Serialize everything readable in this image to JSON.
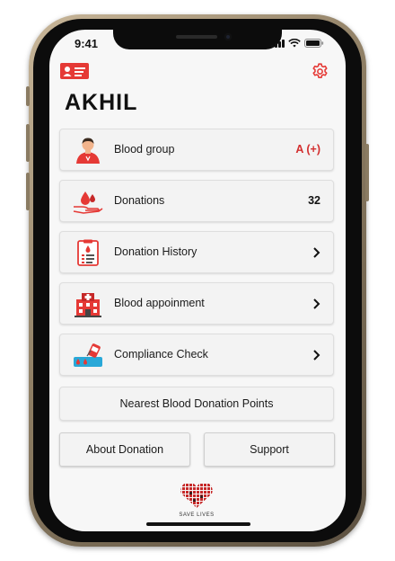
{
  "status_bar": {
    "time": "9:41"
  },
  "header": {
    "user_name": "AKHIL",
    "id_card_icon": "id-card-icon",
    "settings_icon": "gear-icon"
  },
  "menu": [
    {
      "label": "Blood group",
      "value": "A (+)",
      "icon": "donor-icon"
    },
    {
      "label": "Donations",
      "value": "32",
      "icon": "blood-drop-hand-icon"
    },
    {
      "label": "Donation History",
      "value": "",
      "icon": "clipboard-icon"
    },
    {
      "label": "Blood appoinment",
      "value": "",
      "icon": "hospital-icon"
    },
    {
      "label": "Compliance Check",
      "value": "",
      "icon": "blood-bag-icon"
    }
  ],
  "nearest_button": "Nearest Blood Donation Points",
  "about_button": "About Donation",
  "support_button": "Support",
  "logo": {
    "caption": "SAVE LIVES"
  },
  "colors": {
    "accent_red": "#e53935",
    "value_red": "#d32f2f",
    "background": "#f7f7f7"
  }
}
